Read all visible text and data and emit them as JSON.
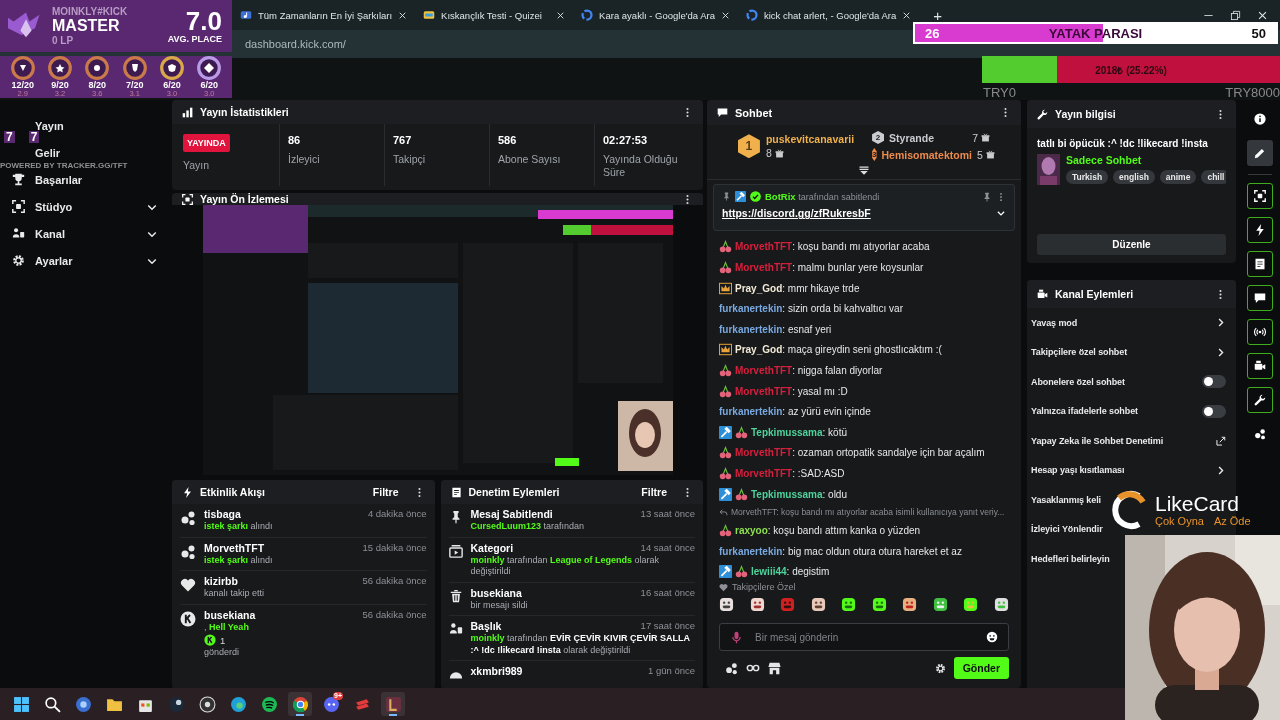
{
  "tft_overlay": {
    "player": "MOINKLY#KICK",
    "rank": "MASTER",
    "lp": "0 LP",
    "avg": "7.0",
    "avg_label": "AVG. PLACE",
    "traits": [
      {
        "fraction": "12/20",
        "avg": "2.9",
        "color": "#c9794a"
      },
      {
        "fraction": "9/20",
        "avg": "3.2",
        "color": "#c9794a"
      },
      {
        "fraction": "8/20",
        "avg": "3.6",
        "color": "#c9794a"
      },
      {
        "fraction": "7/20",
        "avg": "3.1",
        "color": "#c9794a"
      },
      {
        "fraction": "6/20",
        "avg": "3.0",
        "color": "#d9a84a"
      },
      {
        "fraction": "6/20",
        "avg": "3.0",
        "color": "#b89ae8"
      }
    ],
    "corner_values": [
      "7",
      "7"
    ],
    "footer": "POWERED BY TRACKER.GG/TFT"
  },
  "browser": {
    "tabs": [
      {
        "title": "Tüm Zamanların En İyi Şarkıları",
        "selected": false
      },
      {
        "title": "Kıskançlık Testi - Quizei",
        "selected": false
      },
      {
        "title": "Kara ayaklı - Google'da Ara",
        "selected": false
      },
      {
        "title": "kick chat arlert, - Google'da Ara",
        "selected": false
      }
    ],
    "new_tab": "+",
    "url": "dashboard.kick.com/"
  },
  "goal": {
    "current": "26",
    "title": "YATAK PARASI",
    "target": "50",
    "level": 0.52
  },
  "donation": {
    "reading": "2018₺ (25.22%)",
    "level": 0.2522,
    "min": "TRY0",
    "max": "TRY8000"
  },
  "sidebar": {
    "items": [
      {
        "label": "Yayın",
        "expandable": false
      },
      {
        "label": "Gelir",
        "expandable": false
      },
      {
        "label": "Başarılar",
        "expandable": false
      },
      {
        "label": "Stüdyo",
        "expandable": true
      },
      {
        "label": "Kanal",
        "expandable": true
      },
      {
        "label": "Ayarlar",
        "expandable": true
      }
    ]
  },
  "stats": {
    "title": "Yayın İstatistikleri",
    "status": "YAYINDA",
    "status_label": "Yayın",
    "cells": [
      {
        "value": "86",
        "label": "İzleyici"
      },
      {
        "value": "767",
        "label": "Takipçi"
      },
      {
        "value": "586",
        "label": "Abone Sayısı"
      },
      {
        "value": "02:27:53",
        "label": "Yayında Olduğu Süre"
      }
    ]
  },
  "preview": {
    "title": "Yayın Ön İzlemesi",
    "kind": "picture"
  },
  "activity": {
    "title": "Etkinlik Akışı",
    "filter": "Filtre",
    "events": [
      {
        "kind": "song",
        "user": "tisbaga",
        "time": "4 dakika önce",
        "detail": "**istek şarkı** alındı"
      },
      {
        "kind": "song",
        "user": "MorvethTFT",
        "time": "15 dakika önce",
        "detail": "**istek şarkı** alındı"
      },
      {
        "kind": "follow",
        "user": "kizirbb",
        "time": "56 dakika önce",
        "detail": "kanalı takip etti"
      },
      {
        "kind": "kicks",
        "user": "busekiana",
        "time": "56 dakika önce",
        "detail": ", **Hell Yeah**",
        "amount": "1",
        "footer": "gönderdi"
      }
    ]
  },
  "moderation": {
    "title": "Denetim Eylemleri",
    "filter": "Filtre",
    "actions": [
      {
        "kind": "pin",
        "title": "Mesaj Sabitlendi",
        "time": "13 saat önce",
        "detail": "**CursedLuum123** tarafından"
      },
      {
        "kind": "category",
        "title": "Kategori",
        "time": "14 saat önce",
        "detail": "**moinkly** tarafından **League of Legends**  olarak değiştirildi"
      },
      {
        "kind": "delete",
        "title": "busekiana",
        "time": "16 saat önce",
        "detail": "bir mesajı sildi"
      },
      {
        "kind": "title",
        "title": "Başlık",
        "time": "17 saat önce",
        "detail": "**moinkly** tarafından *EVİR ÇEVİR KIVIR ÇEVİR SALLA :^ !dc !likecard !insta* olarak değiştirildi"
      },
      {
        "kind": "user",
        "title": "xkmbri989",
        "time": "1 gün önce"
      }
    ]
  },
  "chat": {
    "title": "Sohbet",
    "leaders": [
      {
        "rank": "1",
        "name": "puskevitcanavarii",
        "count": "8",
        "color": "#f0b04c"
      },
      {
        "rank": "2",
        "name": "Styrande",
        "count": "7",
        "color": "#c9ccd0"
      },
      {
        "rank": "3",
        "name": "Hemisomatektomi",
        "count": "5",
        "color": "#ee8a4a"
      }
    ],
    "pinned": {
      "user": "BotRix",
      "note": "tarafından sabitlendi",
      "link": "https://discord.gg/zfRukresbF"
    },
    "messages": [
      {
        "kind": "message",
        "user": "MorvethTFT",
        "text": ": koşu bandı mı atıyorlar acaba",
        "color": "#d81f3d",
        "mod": false,
        "sub": true,
        "vip": false
      },
      {
        "kind": "message",
        "user": "MorvethTFT",
        "text": ": malmı bunlar yere koysunlar",
        "color": "#d81f3d",
        "mod": false,
        "sub": true,
        "vip": false
      },
      {
        "kind": "message",
        "user": "Pray_God",
        "text": ": mmr hikaye trde",
        "color": "#f3ead8",
        "mod": false,
        "sub": false,
        "vip": true
      },
      {
        "kind": "message",
        "user": "furkanertekin",
        "text": ": sizin orda bi kahvaltıcı var",
        "color": "#79a9e0",
        "mod": false,
        "sub": false,
        "vip": false
      },
      {
        "kind": "message",
        "user": "furkanertekin",
        "text": ": esnaf yeri",
        "color": "#79a9e0",
        "mod": false,
        "sub": false,
        "vip": false
      },
      {
        "kind": "message",
        "user": "Pray_God",
        "text": ": maça gireydin seni ghostlıcaktım :(",
        "color": "#f3ead8",
        "mod": false,
        "sub": false,
        "vip": true
      },
      {
        "kind": "message",
        "user": "MorvethTFT",
        "text": ": nigga falan diyorlar",
        "color": "#d81f3d",
        "mod": false,
        "sub": true,
        "vip": false
      },
      {
        "kind": "message",
        "user": "MorvethTFT",
        "text": ": yasal mı :D",
        "color": "#d81f3d",
        "mod": false,
        "sub": true,
        "vip": false
      },
      {
        "kind": "message",
        "user": "furkanertekin",
        "text": ": az yürü evin içinde",
        "color": "#79a9e0",
        "mod": false,
        "sub": false,
        "vip": false
      },
      {
        "kind": "message",
        "user": "Tepkimussama",
        "text": ": kötü",
        "color": "#4fd39c",
        "mod": true,
        "sub": true,
        "vip": false
      },
      {
        "kind": "message",
        "user": "MorvethTFT",
        "text": ": ozaman ortopatik sandalye için bar açalım",
        "color": "#d81f3d",
        "mod": false,
        "sub": true,
        "vip": false
      },
      {
        "kind": "message",
        "user": "MorvethTFT",
        "text": ": :SAD:ASD",
        "color": "#d81f3d",
        "mod": false,
        "sub": true,
        "vip": false
      },
      {
        "kind": "message",
        "user": "Tepkimussama",
        "text": ": oldu",
        "color": "#4fd39c",
        "mod": true,
        "sub": true,
        "vip": false
      },
      {
        "kind": "reply",
        "text": "MorvethTFT: koşu bandı mı atıyorlar acaba isimli kullanıcıya yanıt veriy..."
      },
      {
        "kind": "message",
        "user": "raxyoo",
        "text": ": koşu bandı attım kanka o yüzden",
        "color": "#8ee04f",
        "mod": false,
        "sub": true,
        "vip": false
      },
      {
        "kind": "message",
        "user": "furkanertekin",
        "text": ": big mac oldun otura otura hareket et az",
        "color": "#79a9e0",
        "mod": false,
        "sub": false,
        "vip": false
      },
      {
        "kind": "message",
        "user": "lewiii44",
        "text": ": degistim",
        "color": "#4fd39c",
        "mod": true,
        "sub": true,
        "vip": false
      }
    ],
    "emote_label": "Takipçilere Özel",
    "placeholder": "Bir mesaj gönderin",
    "send": "Gönder"
  },
  "stream_info": {
    "title": "Yayın bilgisi",
    "stream_title": "tatlı bi öpücük :^ !dc !likecard !insta",
    "category": "Sadece Sohbet",
    "tags": [
      "Turkish",
      "english",
      "anime",
      "chill"
    ],
    "edit": "Düzenle"
  },
  "channel_actions": {
    "title": "Kanal Eylemleri",
    "rows": [
      {
        "label": "Yavaş mod",
        "kind": "nav"
      },
      {
        "label": "Takipçilere özel sohbet",
        "kind": "nav"
      },
      {
        "label": "Abonelere özel sohbet",
        "kind": "toggle",
        "on": false
      },
      {
        "label": "Yalnızca ifadelerle sohbet",
        "kind": "toggle",
        "on": false
      },
      {
        "label": "Yapay Zeka ile Sohbet Denetimi",
        "kind": "link"
      },
      {
        "label": "Hesap yaşı kısıtlaması",
        "kind": "nav"
      },
      {
        "label": "Yasaklanmış keli",
        "kind": "plain"
      },
      {
        "label": "İzleyici Yönlendir",
        "kind": "plain"
      },
      {
        "label": "Hedefleri belirleyin",
        "kind": "plain"
      }
    ]
  },
  "rail": [
    {
      "selected": false
    },
    {
      "selected": true
    },
    {
      "selected": false
    },
    {
      "selected": false
    },
    {
      "selected": false
    },
    {
      "selected": false
    },
    {
      "selected": false
    },
    {
      "selected": false
    },
    {
      "selected": false
    },
    {
      "selected": false
    }
  ],
  "logo": {
    "name": "LikeCard",
    "slogan_1": "Çok Oyna",
    "slogan_2": "Az Öde"
  },
  "taskbar": {
    "apps": [
      {
        "active": false
      },
      {
        "active": false
      },
      {
        "active": false
      },
      {
        "active": false
      },
      {
        "active": false
      },
      {
        "active": false
      },
      {
        "active": false
      },
      {
        "active": false
      },
      {
        "active": false
      },
      {
        "active": true
      },
      {
        "active": false,
        "badge": "9+"
      },
      {
        "active": false
      },
      {
        "active": true
      }
    ]
  }
}
